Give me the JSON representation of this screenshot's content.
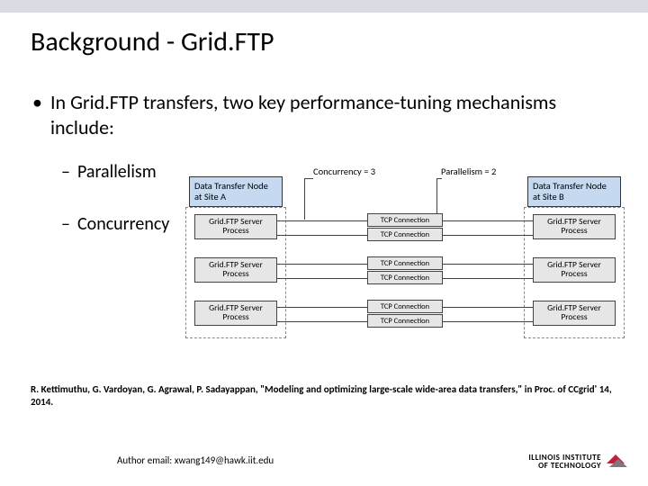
{
  "title": "Background - Grid.FTP",
  "main_bullet": "In Grid.FTP transfers, two key performance-tuning mechanisms include:",
  "sub_bullets": [
    "Parallelism",
    "Concurrency"
  ],
  "diagram": {
    "nodeA": "Data Transfer Node at Site A",
    "nodeB": "Data Transfer Node at Site B",
    "proc_label": "Grid.FTP Server Process",
    "tcp_label": "TCP Connection",
    "annot_concurrency": "Concurrency = 3",
    "annot_parallelism": "Parallelism = 2"
  },
  "citation": "R. Kettimuthu, G. Vardoyan, G. Agrawal, P. Sadayappan, \"Modeling and optimizing large-scale wide-area data transfers,\" in Proc. of CCgrid' 14, 2014.",
  "footer": "Author email: xwang149@hawk.iit.edu",
  "logo_line1": "ILLINOIS INSTITUTE",
  "logo_line2": "OF TECHNOLOGY"
}
